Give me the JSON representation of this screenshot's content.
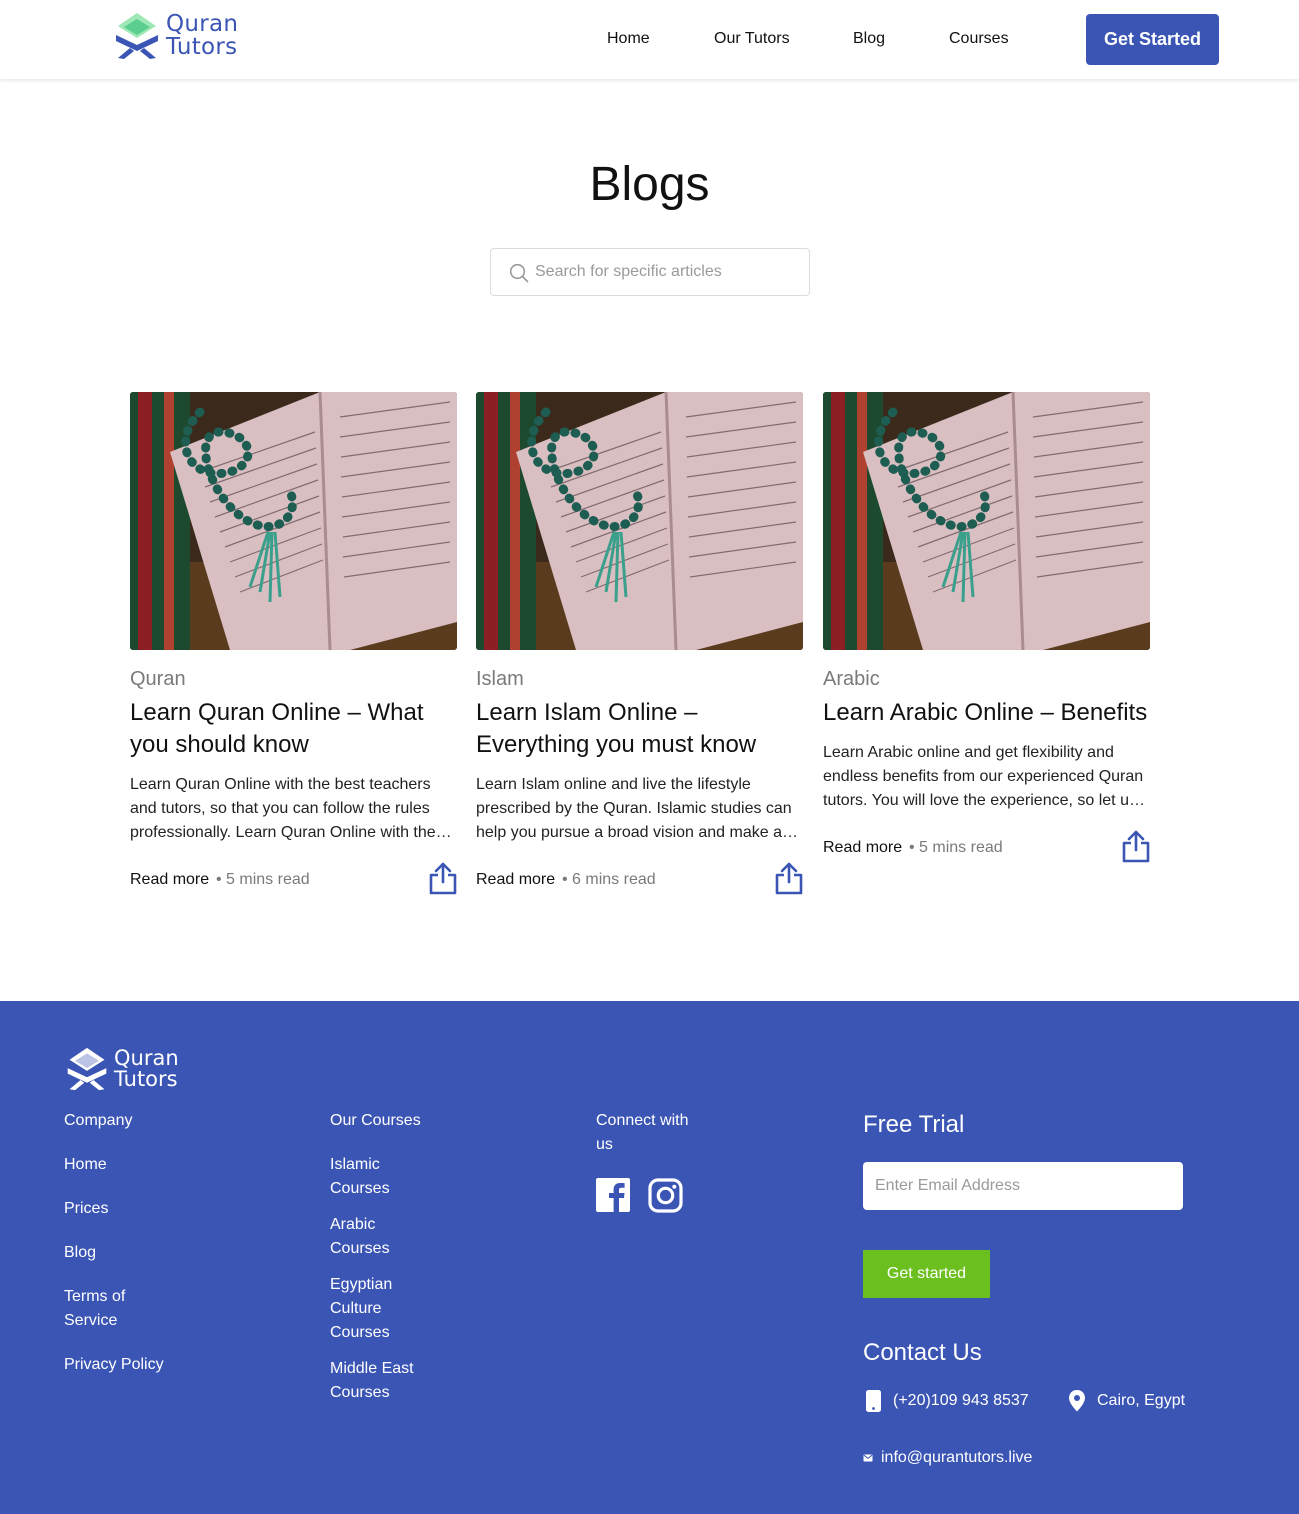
{
  "brand": {
    "line1": "Quran",
    "line2": "Tutors"
  },
  "nav": {
    "home": "Home",
    "tutors": "Our Tutors",
    "blog": "Blog",
    "courses": "Courses"
  },
  "header": {
    "cta": "Get Started"
  },
  "page": {
    "title": "Blogs",
    "search_placeholder": "Search for specific articles"
  },
  "cards": [
    {
      "category": "Quran",
      "title": "Learn Quran Online – What you should know",
      "description": "Learn Quran Online with the best teachers and tutors, so that you can follow the rules professionally. Learn Quran Online with the best teachers and tutors.",
      "read_more": "Read more",
      "read_time": "5 mins read"
    },
    {
      "category": "Islam",
      "title": "Learn Islam Online – Everything you must know",
      "description": "Learn Islam online and live the lifestyle prescribed by the Quran. Islamic studies can help you pursue a broad vision and make a difference.",
      "read_more": "Read more",
      "read_time": "6 mins read"
    },
    {
      "category": "Arabic",
      "title": "Learn Arabic Online – Benefits",
      "description": "Learn Arabic online and get flexibility and endless benefits from our experienced Quran tutors. You will love the experience, so let us begin.",
      "read_more": "Read more",
      "read_time": "5 mins read"
    }
  ],
  "footer": {
    "company": {
      "heading": "Company",
      "links": [
        "Home",
        "Prices",
        "Blog",
        "Terms of Service",
        "Privacy Policy"
      ]
    },
    "courses": {
      "heading": "Our Courses",
      "links": [
        "Islamic Courses",
        "Arabic Courses",
        "Egyptian Culture Courses",
        "Middle East Courses"
      ]
    },
    "connect": {
      "heading": "Connect with us",
      "icons": [
        "facebook-icon",
        "instagram-icon"
      ]
    },
    "trial": {
      "heading": "Free Trial",
      "email_placeholder": "Enter Email Address",
      "button": "Get started"
    },
    "contact": {
      "heading": "Contact Us",
      "phone": "(+20)109 943 8537",
      "location": "Cairo, Egypt",
      "email": "info@qurantutors.live"
    }
  },
  "colors": {
    "brand": "#3b55b4",
    "accent_green": "#6bbf1f",
    "logo_green": "#7ed6a5"
  }
}
